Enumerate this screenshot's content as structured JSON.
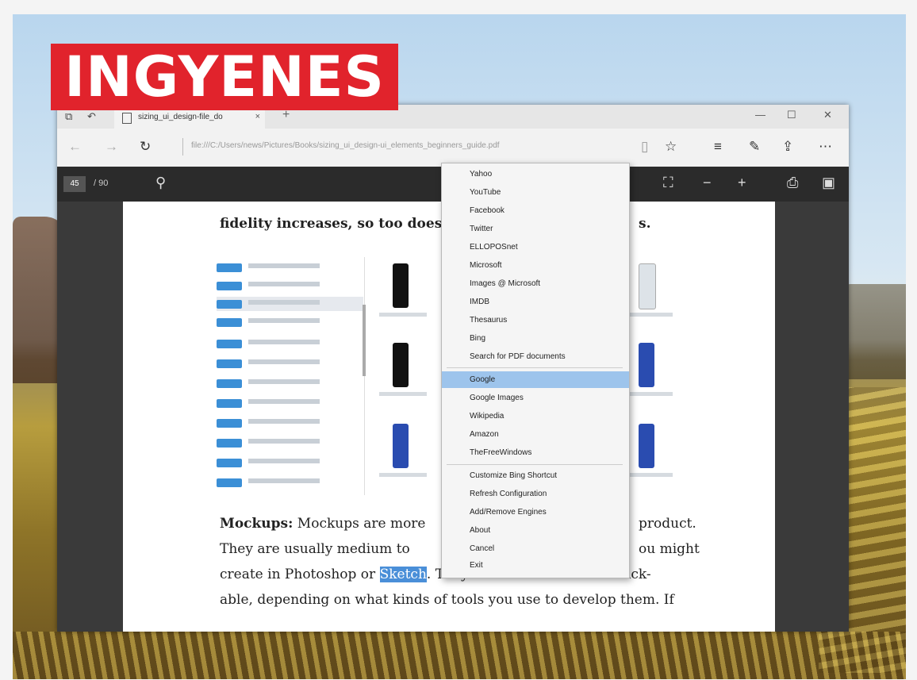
{
  "badge": "INGYENES",
  "browser": {
    "tab_title": "sizing_ui_design-file_do",
    "tab_close": "×",
    "new_tab": "+",
    "url": "file:///C:/Users/news/Pictures/Books/sizing_ui_design-ui_elements_beginners_guide.pdf"
  },
  "pdf_toolbar": {
    "page": "45",
    "total": "/ 90"
  },
  "document": {
    "line_top": "fidelity increases, so too does",
    "line_top_end": "s.",
    "mockups_label": "Mockups:",
    "line1a": "Mockups are more",
    "line1b": "product.",
    "line2a": "They are usually medium to",
    "line2b": "ou might",
    "line3a": "create in Photoshop or",
    "line3_sel": "Sketch",
    "line3b": ". They can also be static or click-",
    "line4": "able, depending on what kinds of tools you use to develop them. If"
  },
  "context_menu": {
    "items": [
      "Yahoo",
      "YouTube",
      "Facebook",
      "Twitter",
      "ELLOPOSnet",
      "Microsoft",
      "Images @ Microsoft",
      "IMDB",
      "Thesaurus",
      "Bing",
      "Search for PDF documents",
      "Google",
      "Google Images",
      "Wikipedia",
      "Amazon",
      "TheFreeWindows",
      "Customize Bing Shortcut",
      "Refresh Configuration",
      "Add/Remove Engines",
      "About",
      "Cancel",
      "Exit"
    ],
    "selected_item": "Google"
  }
}
